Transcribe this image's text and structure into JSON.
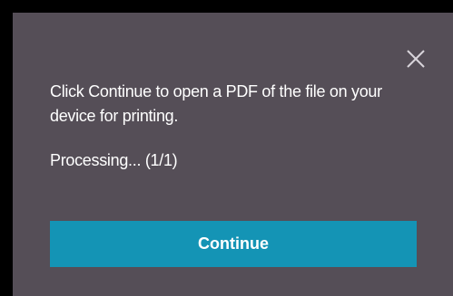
{
  "dialog": {
    "message": "Click Continue to open a PDF of the file on your device for printing.",
    "status": "Processing... (1/1)",
    "continue_label": "Continue",
    "close_icon": "close-icon"
  },
  "colors": {
    "background": "#554e57",
    "button": "#1494b5",
    "text": "#ffffff"
  }
}
